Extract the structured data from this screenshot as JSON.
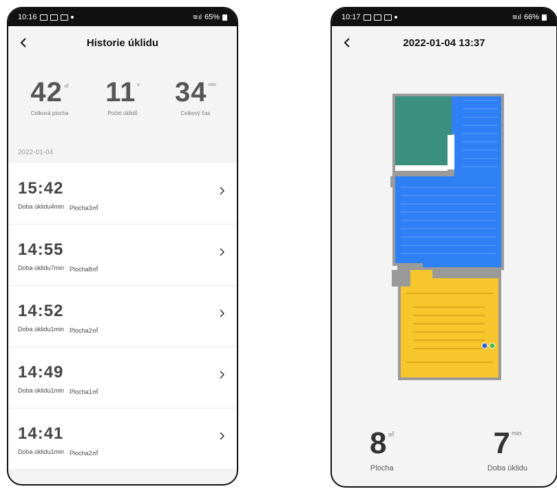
{
  "left": {
    "status_bar": {
      "time": "10:16",
      "battery": "65%"
    },
    "header": {
      "title": "Historie úklidu"
    },
    "summary": [
      {
        "value": "42",
        "unit": "㎡",
        "label": "Celková plocha"
      },
      {
        "value": "11",
        "unit": "x",
        "label": "Počet úklidů"
      },
      {
        "value": "34",
        "unit": "min",
        "label": "Celkový čas"
      }
    ],
    "date": "2022-01-04",
    "records": [
      {
        "time": "15:42",
        "duration": "Doba úklidu4min",
        "area": "Plocha3㎡"
      },
      {
        "time": "14:55",
        "duration": "Doba úklidu7min",
        "area": "Plocha8㎡"
      },
      {
        "time": "14:52",
        "duration": "Doba úklidu1min",
        "area": "Plocha2㎡"
      },
      {
        "time": "14:49",
        "duration": "Doba úklidu1min",
        "area": "Plocha1㎡"
      },
      {
        "time": "14:41",
        "duration": "Doba úklidu1min",
        "area": "Plocha2㎡"
      }
    ]
  },
  "right": {
    "status_bar": {
      "time": "10:17",
      "battery": "66%"
    },
    "header": {
      "title": "2022-01-04 13:37"
    },
    "map_colors": {
      "green": "#3a8f7e",
      "blue": "#2f80f5",
      "yellow": "#f6c62c",
      "wall": "#9a9a9a"
    },
    "stats": [
      {
        "value": "8",
        "unit": "㎡",
        "label": "Plocha"
      },
      {
        "value": "7",
        "unit": "min",
        "label": "Doba úklidu"
      }
    ]
  }
}
